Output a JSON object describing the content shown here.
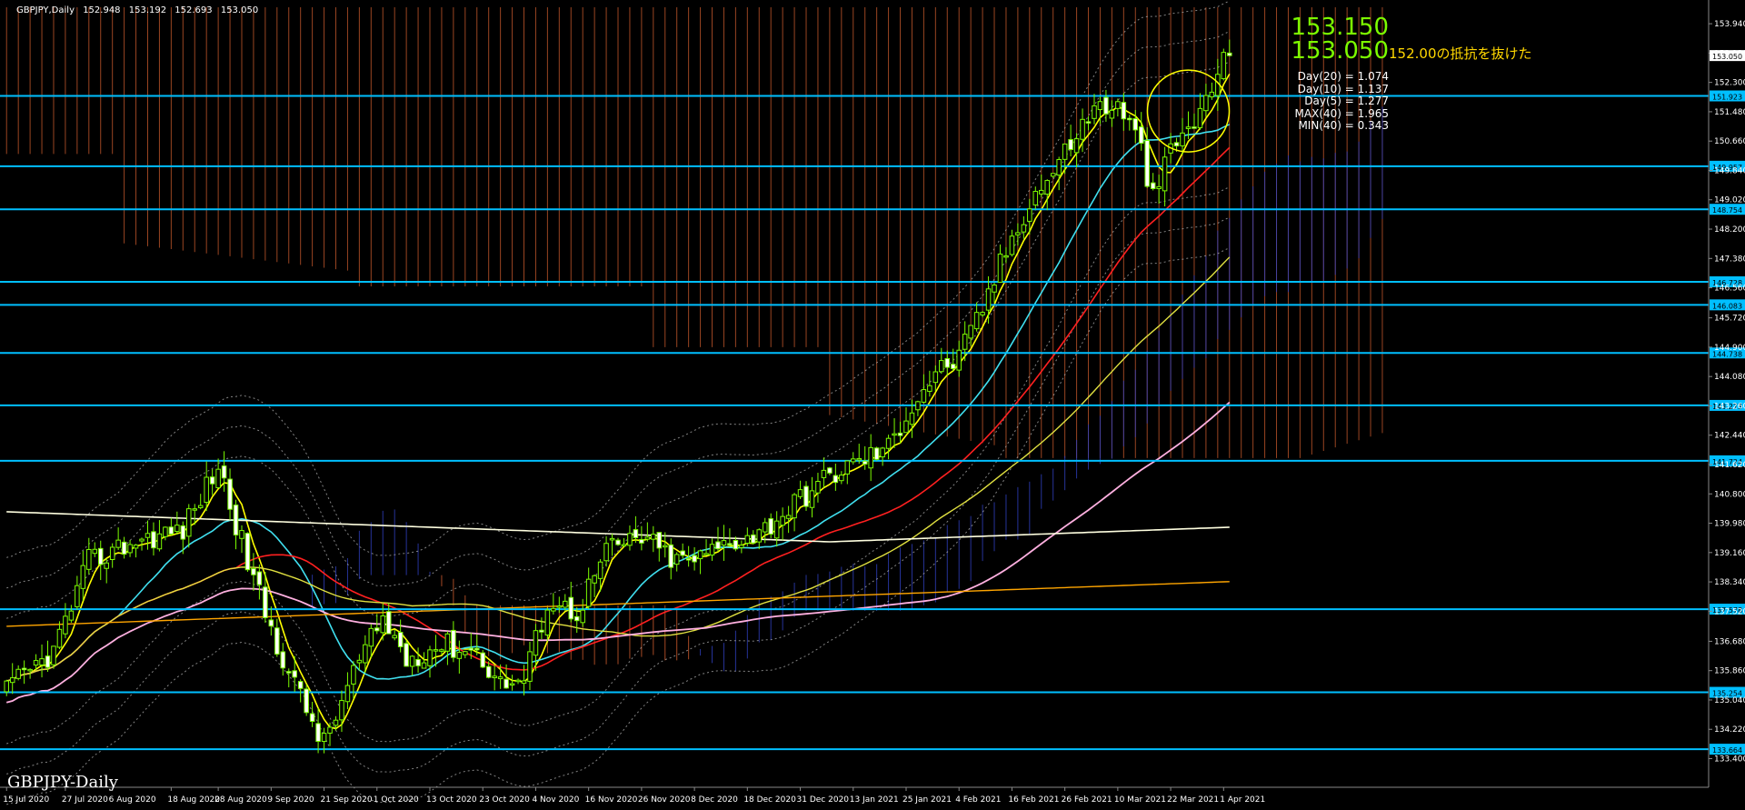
{
  "header": {
    "symbol": "GBPJPY,Daily",
    "ohlc": [
      "152.948",
      "153.192",
      "152.693",
      "153.050"
    ]
  },
  "prices": {
    "ask": "153.150",
    "bid": "153.050"
  },
  "indicators": [
    "Day(20) = 1.074",
    "Day(10) = 1.137",
    "Day(5) = 1.277",
    "MAX(40) = 1.965",
    "MIN(40) = 0.343"
  ],
  "annotation": "152.00の抵抗を抜けた",
  "watermark": "GBPJPY-Daily",
  "colors": {
    "background": "#000000",
    "candle": "#7CFC00",
    "cloud": "#CD5C2E",
    "hline": "#00BFFF",
    "ma_yellow": "#FFFF00",
    "ma_cyan": "#40E0F0",
    "ma_red": "#FF2020",
    "ma_pink": "#FFB0E0",
    "ma_white": "#FFFFE0",
    "ma_orange": "#FFA500",
    "circle": "#FFFF00"
  },
  "chart_data": {
    "type": "candlestick",
    "ylim": [
      132.6,
      154.4
    ],
    "y_ticks": [
      "153.940",
      "153.120",
      "152.300",
      "151.480",
      "150.660",
      "149.840",
      "149.020",
      "148.200",
      "147.380",
      "146.560",
      "145.720",
      "144.900",
      "144.080",
      "143.260",
      "142.440",
      "141.620",
      "140.800",
      "139.980",
      "139.160",
      "138.340",
      "137.520",
      "136.680",
      "135.860",
      "135.040",
      "134.220",
      "133.400"
    ],
    "x_labels": [
      "15 Jul 2020",
      "27 Jul 2020",
      "6 Aug 2020",
      "18 Aug 2020",
      "28 Aug 2020",
      "9 Sep 2020",
      "21 Sep 2020",
      "1 Oct 2020",
      "13 Oct 2020",
      "23 Oct 2020",
      "4 Nov 2020",
      "16 Nov 2020",
      "26 Nov 2020",
      "8 Dec 2020",
      "18 Dec 2020",
      "31 Dec 2020",
      "13 Jan 2021",
      "25 Jan 2021",
      "4 Feb 2021",
      "16 Feb 2021",
      "26 Feb 2021",
      "10 Mar 2021",
      "22 Mar 2021",
      "1 Apr 2021"
    ],
    "x_label_bars": [
      0,
      10,
      18,
      28,
      36,
      45,
      54,
      63,
      72,
      81,
      90,
      99,
      108,
      117,
      126,
      135,
      144,
      153,
      162,
      171,
      180,
      189,
      198,
      207
    ],
    "horizontal_lines": [
      {
        "price": 151.923,
        "label": "151.923"
      },
      {
        "price": 149.957,
        "label": "149.957"
      },
      {
        "price": 148.754,
        "label": "148.754"
      },
      {
        "price": 146.728,
        "label": "146.728"
      },
      {
        "price": 146.083,
        "label": "146.083"
      },
      {
        "price": 144.738,
        "label": "144.738"
      },
      {
        "price": 143.273,
        "label": "143.273"
      },
      {
        "price": 141.724,
        "label": "141.724"
      },
      {
        "price": 137.578,
        "label": "137.578"
      },
      {
        "price": 135.254,
        "label": "135.254"
      },
      {
        "price": 133.664,
        "label": "133.664"
      }
    ],
    "current_price_label": "153.050",
    "close_path": [
      [
        0,
        135.3
      ],
      [
        8,
        136.4
      ],
      [
        14,
        138.9
      ],
      [
        22,
        139.5
      ],
      [
        30,
        139.8
      ],
      [
        36,
        141.6
      ],
      [
        41,
        138.9
      ],
      [
        45,
        137.0
      ],
      [
        50,
        135.1
      ],
      [
        54,
        133.8
      ],
      [
        59,
        135.8
      ],
      [
        64,
        137.3
      ],
      [
        68,
        136.2
      ],
      [
        74,
        136.6
      ],
      [
        80,
        136.4
      ],
      [
        84,
        135.5
      ],
      [
        88,
        135.6
      ],
      [
        92,
        137.8
      ],
      [
        97,
        137.5
      ],
      [
        102,
        139.2
      ],
      [
        108,
        139.6
      ],
      [
        114,
        138.9
      ],
      [
        118,
        139.0
      ],
      [
        123,
        139.5
      ],
      [
        128,
        139.7
      ],
      [
        133,
        140.4
      ],
      [
        140,
        141.3
      ],
      [
        146,
        141.8
      ],
      [
        150,
        142.1
      ],
      [
        154,
        143.3
      ],
      [
        158,
        144.2
      ],
      [
        162,
        144.6
      ],
      [
        166,
        146.0
      ],
      [
        170,
        147.6
      ],
      [
        174,
        149.0
      ],
      [
        178,
        149.8
      ],
      [
        182,
        150.9
      ],
      [
        186,
        151.7
      ],
      [
        190,
        151.5
      ],
      [
        193,
        150.4
      ],
      [
        195,
        149.0
      ],
      [
        198,
        150.4
      ],
      [
        201,
        151.0
      ],
      [
        204,
        151.7
      ],
      [
        206,
        152.6
      ],
      [
        208,
        153.05
      ]
    ]
  }
}
